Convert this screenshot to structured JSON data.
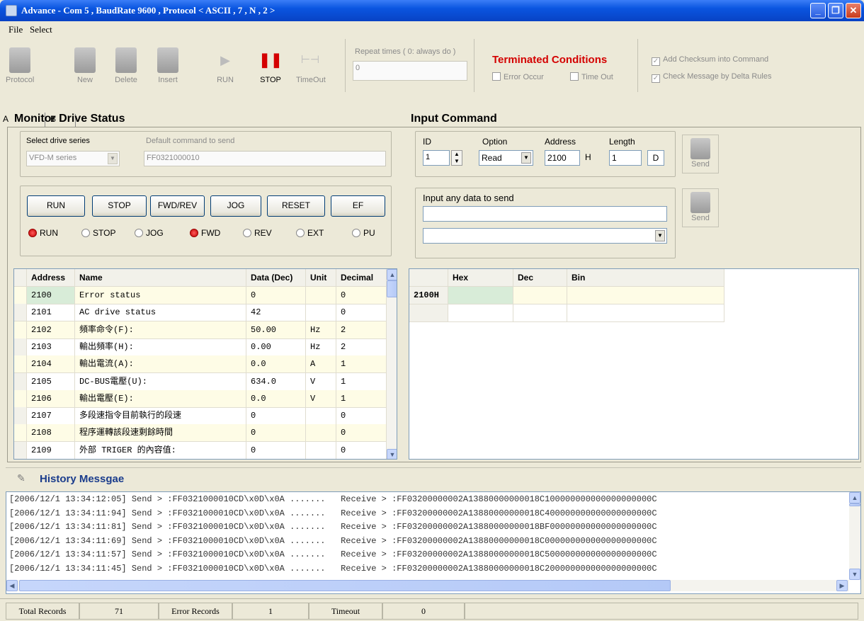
{
  "window": {
    "title": "Advance - Com 5 , BaudRate 9600 , Protocol < ASCII , 7 , N , 2 >"
  },
  "menu": [
    "File",
    "Select"
  ],
  "toolbar": {
    "buttons": [
      "Protocol",
      "New",
      "Delete",
      "Insert",
      "RUN",
      "STOP",
      "TimeOut"
    ],
    "repeat_label": "Repeat times ( 0: always do )",
    "repeat_value": "0",
    "terminated_title": "Terminated Conditions",
    "error_occur": "Error Occur",
    "time_out": "Time Out",
    "add_checksum": "Add Checksum into Command",
    "check_message": "Check Message by Delta Rules"
  },
  "tabs": [
    "A",
    "B"
  ],
  "monitor": {
    "title": "Monitor Drive Status",
    "select_series_label": "Select drive series",
    "select_series_value": "VFD-M series",
    "default_cmd_label": "Default command to send",
    "default_cmd_value": "FF0321000010",
    "buttons": [
      "RUN",
      "STOP",
      "FWD/REV",
      "JOG",
      "RESET",
      "EF"
    ],
    "radios": [
      "RUN",
      "STOP",
      "JOG",
      "FWD",
      "REV",
      "EXT",
      "PU"
    ],
    "headers": [
      "Address",
      "Name",
      "Data (Dec)",
      "Unit",
      "Decimal"
    ],
    "rows": [
      [
        "2100",
        "Error status",
        "0",
        "",
        "0"
      ],
      [
        "2101",
        "AC drive status",
        "42",
        "",
        "0"
      ],
      [
        "2102",
        "頻率命令(F):",
        "50.00",
        "Hz",
        "2"
      ],
      [
        "2103",
        "輸出頻率(H):",
        "0.00",
        "Hz",
        "2"
      ],
      [
        "2104",
        "輸出電流(A):",
        "0.0",
        "A",
        "1"
      ],
      [
        "2105",
        "DC-BUS電壓(U):",
        "634.0",
        "V",
        "1"
      ],
      [
        "2106",
        "輸出電壓(E):",
        "0.0",
        "V",
        "1"
      ],
      [
        "2107",
        "多段速指令目前執行的段速",
        "0",
        "",
        "0"
      ],
      [
        "2108",
        "程序運轉該段速剩餘時間",
        "0",
        "",
        "0"
      ],
      [
        "2109",
        "外部 TRIGER 的內容值:",
        "0",
        "",
        "0"
      ]
    ]
  },
  "input": {
    "title": "Input Command",
    "id_label": "ID",
    "id_value": "1",
    "option_label": "Option",
    "option_value": "Read",
    "address_label": "Address",
    "address_value": "2100",
    "address_suffix": "H",
    "length_label": "Length",
    "length_value": "1",
    "d_button": "D",
    "send": "Send",
    "any_data_label": "Input any data to send",
    "headers": [
      "Hex",
      "Dec",
      "Bin"
    ],
    "row_label": "2100H"
  },
  "history": {
    "title": "History Messgae",
    "lines": [
      "[2006/12/1 13:34:12:05] Send > :FF0321000010CD\\x0D\\x0A .......   Receive > :FF03200000002A13880000000018C100000000000000000000C",
      "[2006/12/1 13:34:11:94] Send > :FF0321000010CD\\x0D\\x0A .......   Receive > :FF03200000002A13880000000018C400000000000000000000C",
      "[2006/12/1 13:34:11:81] Send > :FF0321000010CD\\x0D\\x0A .......   Receive > :FF03200000002A13880000000018BF00000000000000000000C",
      "[2006/12/1 13:34:11:69] Send > :FF0321000010CD\\x0D\\x0A .......   Receive > :FF03200000002A13880000000018C000000000000000000000C",
      "[2006/12/1 13:34:11:57] Send > :FF0321000010CD\\x0D\\x0A .......   Receive > :FF03200000002A13880000000018C500000000000000000000C",
      "[2006/12/1 13:34:11:45] Send > :FF0321000010CD\\x0D\\x0A .......   Receive > :FF03200000002A13880000000018C200000000000000000000C"
    ]
  },
  "status": {
    "total_label": "Total Records",
    "total_value": "71",
    "error_label": "Error Records",
    "error_value": "1",
    "timeout_label": "Timeout",
    "timeout_value": "0"
  },
  "colors": {
    "accent_red": "#d40000",
    "title_blue": "#0a55e0",
    "history_blue": "#1a3c8c"
  }
}
